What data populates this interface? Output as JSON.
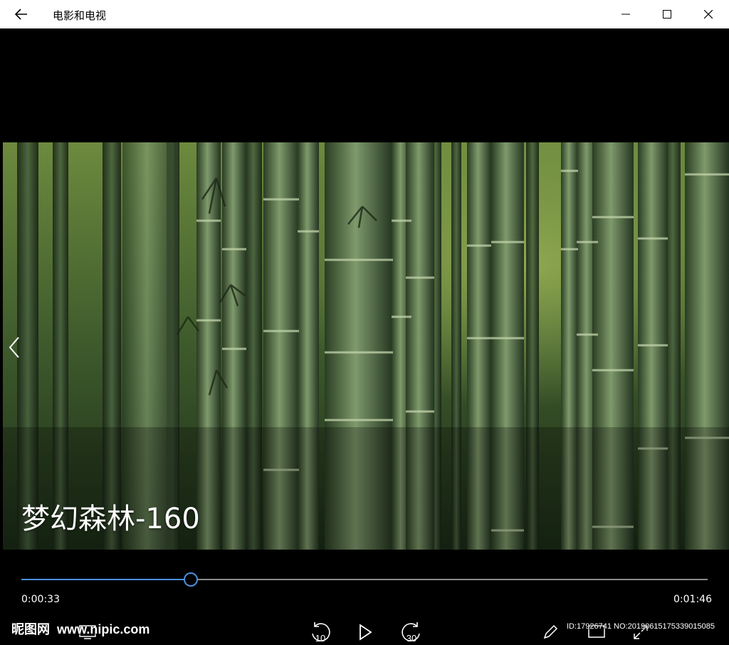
{
  "window": {
    "title": "电影和电视"
  },
  "video": {
    "caption": "梦幻森林-160",
    "elapsed": "0:00:33",
    "total": "0:01:46",
    "progress_fraction": 0.247
  },
  "controls": {
    "rewind_label": "10",
    "forward_label": "30"
  },
  "watermark": {
    "logo_text": "昵图网",
    "site": "www.nipic.com",
    "id_text": "ID:17926741 NO:20190615175339015085"
  },
  "colors": {
    "accent": "#4a90e2",
    "titlebar_bg": "#ffffff",
    "video_bg": "#000000"
  },
  "icons": {
    "back": "arrow-left-icon",
    "minimize": "minimize-icon",
    "maximize": "maximize-icon",
    "close": "close-icon",
    "previous": "chevron-left-icon",
    "rewind": "rewind-10-icon",
    "play": "play-icon",
    "forward": "forward-30-icon",
    "pen": "pen-icon",
    "expand": "expand-icon"
  }
}
